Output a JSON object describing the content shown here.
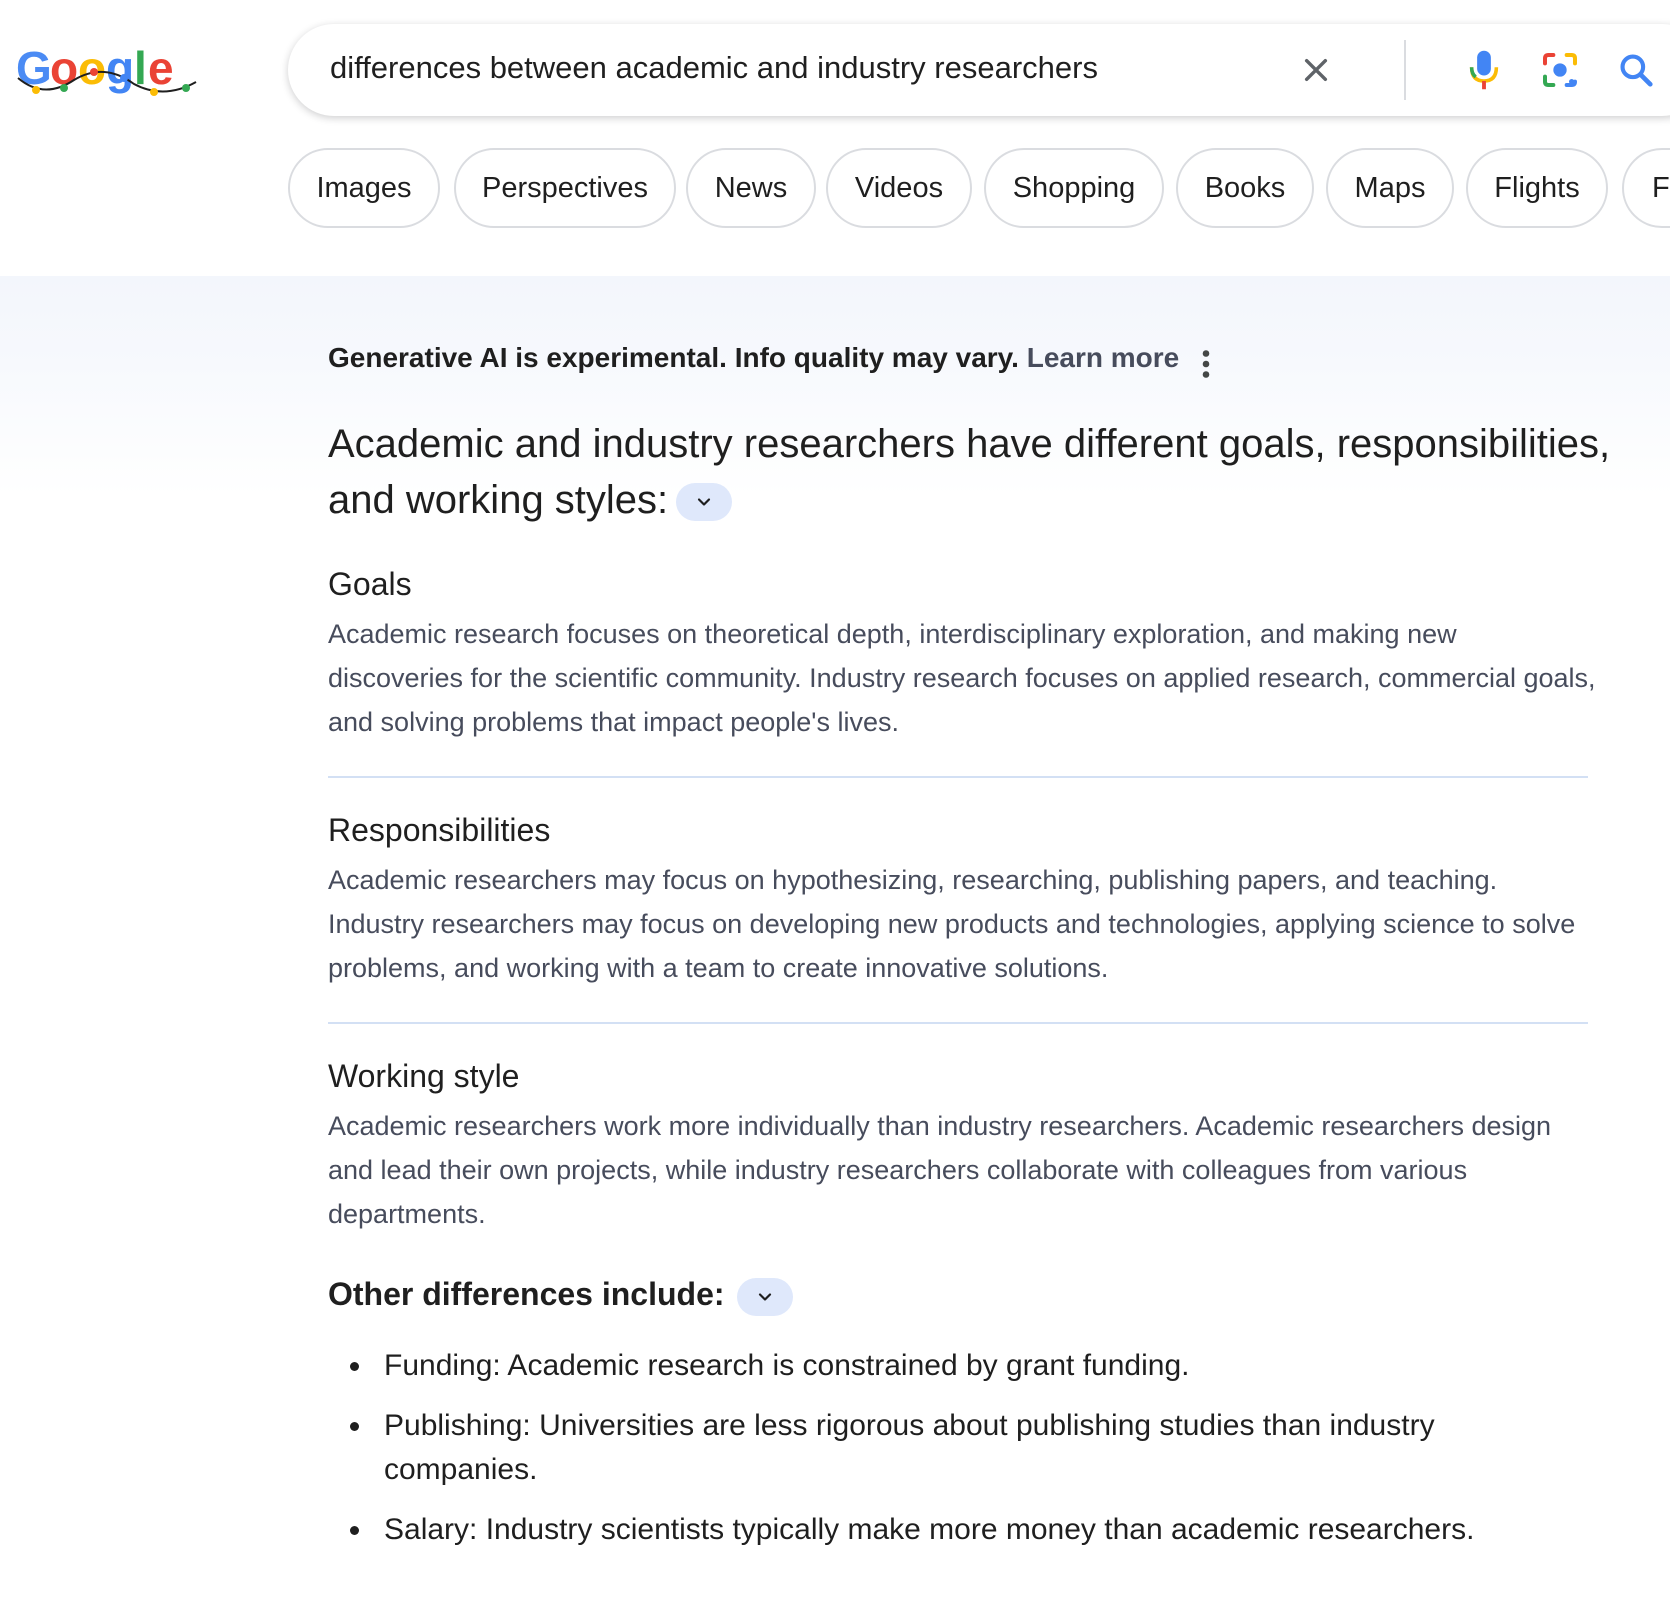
{
  "logo": {
    "text": "Google"
  },
  "search": {
    "query": "differences between academic and industry researchers",
    "clear_icon": "close-icon",
    "voice_icon": "mic-icon",
    "lens_icon": "camera-lens-icon",
    "search_icon": "search-icon"
  },
  "chips": [
    "Images",
    "Perspectives",
    "News",
    "Videos",
    "Shopping",
    "Books",
    "Maps",
    "Flights",
    "Fi"
  ],
  "ai_overview": {
    "disclaimer": "Generative AI is experimental. Info quality may vary.",
    "learn_more": "Learn more",
    "headline": "Academic and industry researchers have different goals, responsibilities, and working styles:",
    "sections": [
      {
        "title": "Goals",
        "body": "Academic research focuses on theoretical depth, interdisciplinary exploration, and making new discoveries for the scientific community. Industry research focuses on applied research, commercial goals, and solving problems that impact people's lives."
      },
      {
        "title": "Responsibilities",
        "body": "Academic researchers may focus on hypothesizing, researching, publishing papers, and teaching. Industry researchers may focus on developing new products and technologies, applying science to solve problems, and working with a team to create innovative solutions."
      },
      {
        "title": "Working style",
        "body": "Academic researchers work more individually than industry researchers. Academic researchers design and lead their own projects, while industry researchers collaborate with colleagues from various departments."
      }
    ],
    "other_title": "Other differences include:",
    "other_items": [
      "Funding: Academic research is constrained by grant funding.",
      "Publishing: Universities are less rigorous about publishing studies than industry companies.",
      "Salary: Industry scientists typically make more money than academic researchers."
    ]
  },
  "colors": {
    "accent_blue": "#1a73e8",
    "chip_border": "#dadce0",
    "body_text": "#474c5c",
    "pill_bg": "#dfe8fb"
  }
}
